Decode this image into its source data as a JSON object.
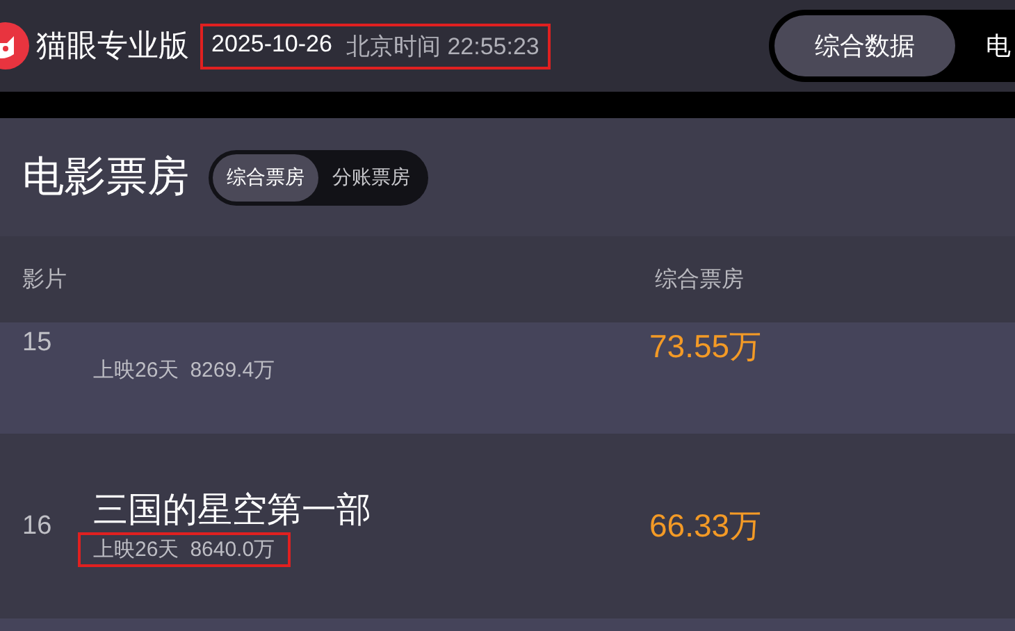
{
  "header": {
    "brand": "猫眼专业版",
    "date": "2025-10-26",
    "time_label": "北京时间",
    "time": "22:55:23",
    "highlighted": true
  },
  "nav_tabs": [
    {
      "label": "综合数据",
      "selected": true
    },
    {
      "label": "电",
      "selected": false
    }
  ],
  "section": {
    "title": "电影票房",
    "tabs": [
      {
        "label": "综合票房",
        "selected": true
      },
      {
        "label": "分账票房",
        "selected": false
      }
    ]
  },
  "table": {
    "columns": [
      "影片",
      "综合票房"
    ],
    "rows": [
      {
        "rank": "15",
        "days": "上映26天",
        "total": "8269.4万",
        "box_office": "73.55万",
        "highlighted": false
      },
      {
        "rank": "16",
        "title": "三国的星空第一部",
        "days": "上映26天",
        "total": "8640.0万",
        "box_office": "66.33万",
        "highlighted": true
      }
    ]
  }
}
